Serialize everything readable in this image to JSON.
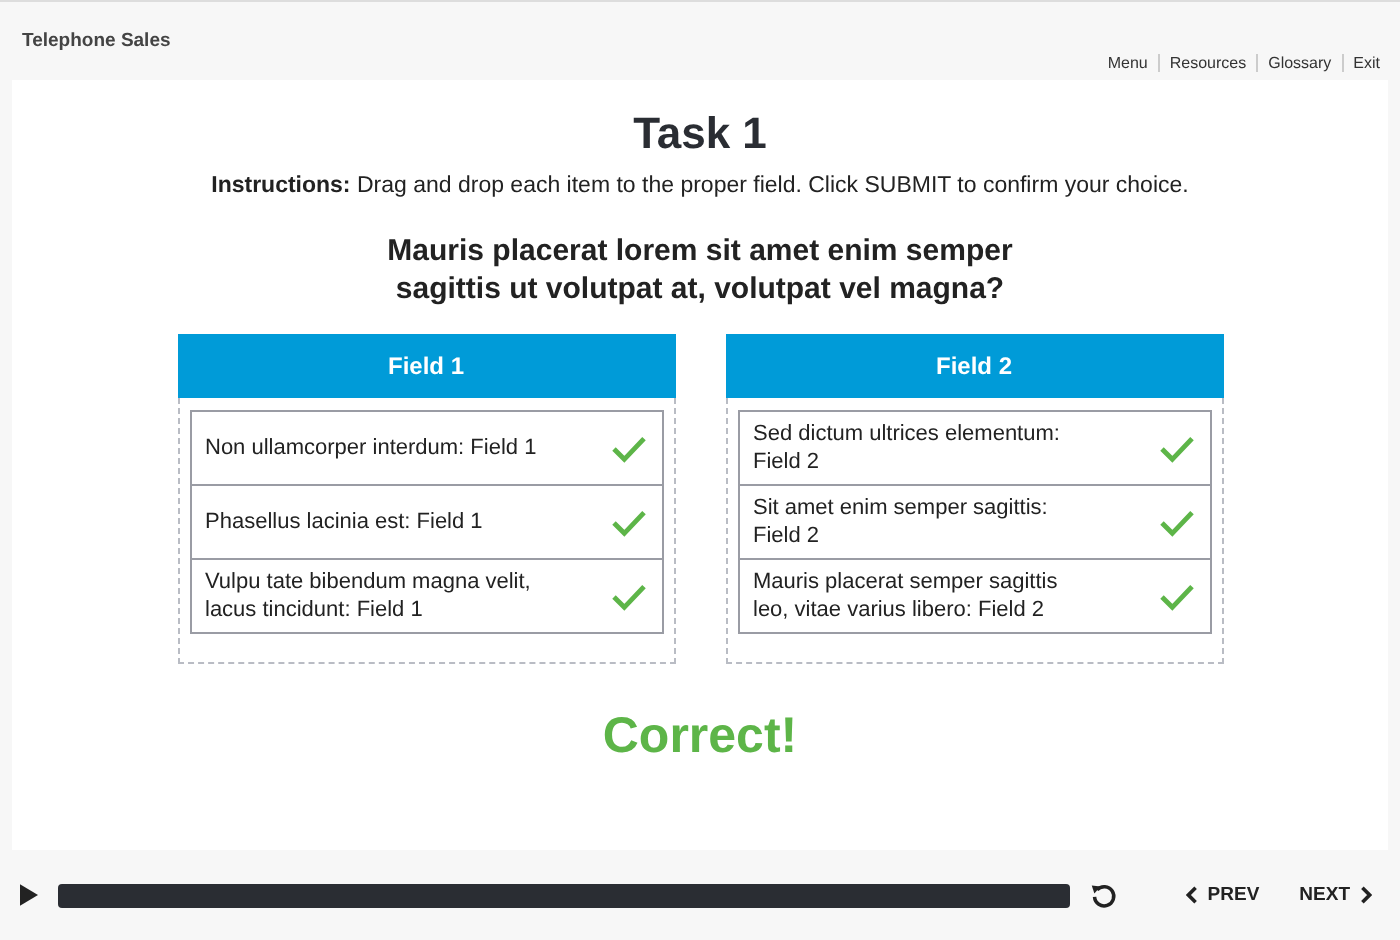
{
  "course_title": "Telephone Sales",
  "nav_links": [
    "Menu",
    "Resources",
    "Glossary",
    "Exit"
  ],
  "task_title": "Task 1",
  "instructions": "**Instructions:** Drag and drop each item to the proper field. Click SUBMIT to confirm your choice.",
  "question": "Mauris placerat lorem sit amet enim semper sagittis ut volutpat at, volutpat vel magna?",
  "fields": [
    {
      "title": "Field 1",
      "items": [
        {
          "text": "Non ullamcorper interdum: Field 1",
          "correct": true
        },
        {
          "text": "Phasellus lacinia est: Field 1",
          "correct": true
        },
        {
          "text": "Vulpu tate bibendum magna velit, lacus tincidunt: Field 1",
          "correct": true
        }
      ]
    },
    {
      "title": "Field 2",
      "items": [
        {
          "text": "Sed dictum ultrices elementum: Field 2",
          "correct": true
        },
        {
          "text": "Sit amet enim semper sagittis: Field 2",
          "correct": true
        },
        {
          "text": "Mauris placerat semper sagittis leo, vitae varius libero: Field 2",
          "correct": true
        }
      ]
    }
  ],
  "feedback": "Correct!",
  "player": {
    "level": 1,
    "prev": "PREV",
    "next": "NEXT"
  }
}
